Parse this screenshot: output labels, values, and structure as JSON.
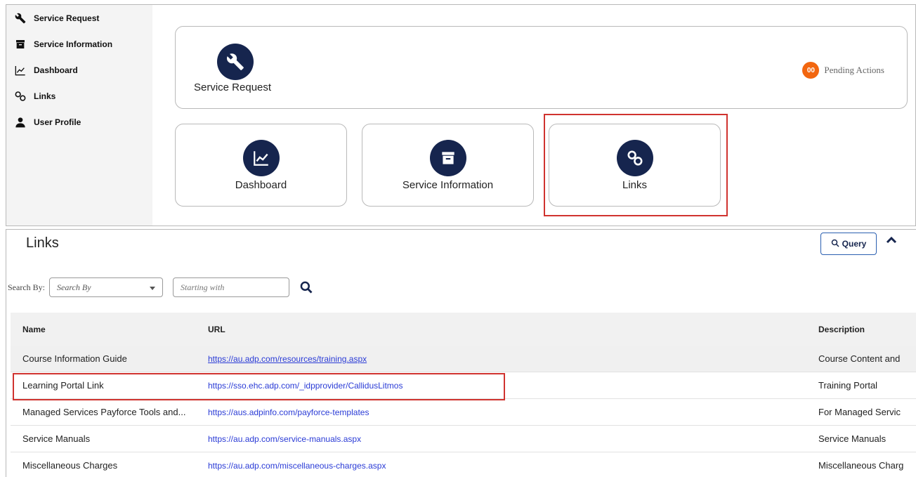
{
  "sidebar": {
    "items": [
      {
        "label": "Service Request",
        "icon": "wrench-icon"
      },
      {
        "label": "Service Information",
        "icon": "archive-box-icon"
      },
      {
        "label": "Dashboard",
        "icon": "trend-chart-icon"
      },
      {
        "label": "Links",
        "icon": "chain-link-icon"
      },
      {
        "label": "User Profile",
        "icon": "user-icon"
      }
    ]
  },
  "tiles": {
    "service_request": {
      "label": "Service Request",
      "icon": "wrench-icon"
    },
    "pending": {
      "count": "00",
      "label": "Pending Actions"
    },
    "dashboard": {
      "label": "Dashboard",
      "icon": "trend-chart-icon"
    },
    "service_information": {
      "label": "Service Information",
      "icon": "archive-box-icon"
    },
    "links": {
      "label": "Links",
      "icon": "chain-link-icon"
    }
  },
  "links_panel": {
    "title": "Links",
    "query_label": "Query",
    "search_by_label": "Search By:",
    "search_by_placeholder": "Search By",
    "starting_placeholder": "Starting with",
    "columns": [
      "Name",
      "URL",
      "Description"
    ],
    "rows": [
      {
        "name": "Course Information Guide",
        "url": "https://au.adp.com/resources/training.aspx",
        "description": "Course Content and"
      },
      {
        "name": "Learning Portal Link",
        "url": "https://sso.ehc.adp.com/_idpprovider/CallidusLitmos",
        "description": "Training Portal"
      },
      {
        "name": "Managed Services Payforce Tools and...",
        "url": "https://aus.adpinfo.com/payforce-templates",
        "description": "For Managed Servic"
      },
      {
        "name": "Service Manuals",
        "url": "https://au.adp.com/service-manuals.aspx",
        "description": "Service Manuals"
      },
      {
        "name": "Miscellaneous Charges",
        "url": "https://au.adp.com/miscellaneous-charges.aspx",
        "description": "Miscellaneous Charg"
      }
    ]
  },
  "colors": {
    "navy": "#16254e",
    "pending_orange": "#f2660f",
    "highlight_red": "#d0332f",
    "link_blue": "#2a3bd6"
  }
}
